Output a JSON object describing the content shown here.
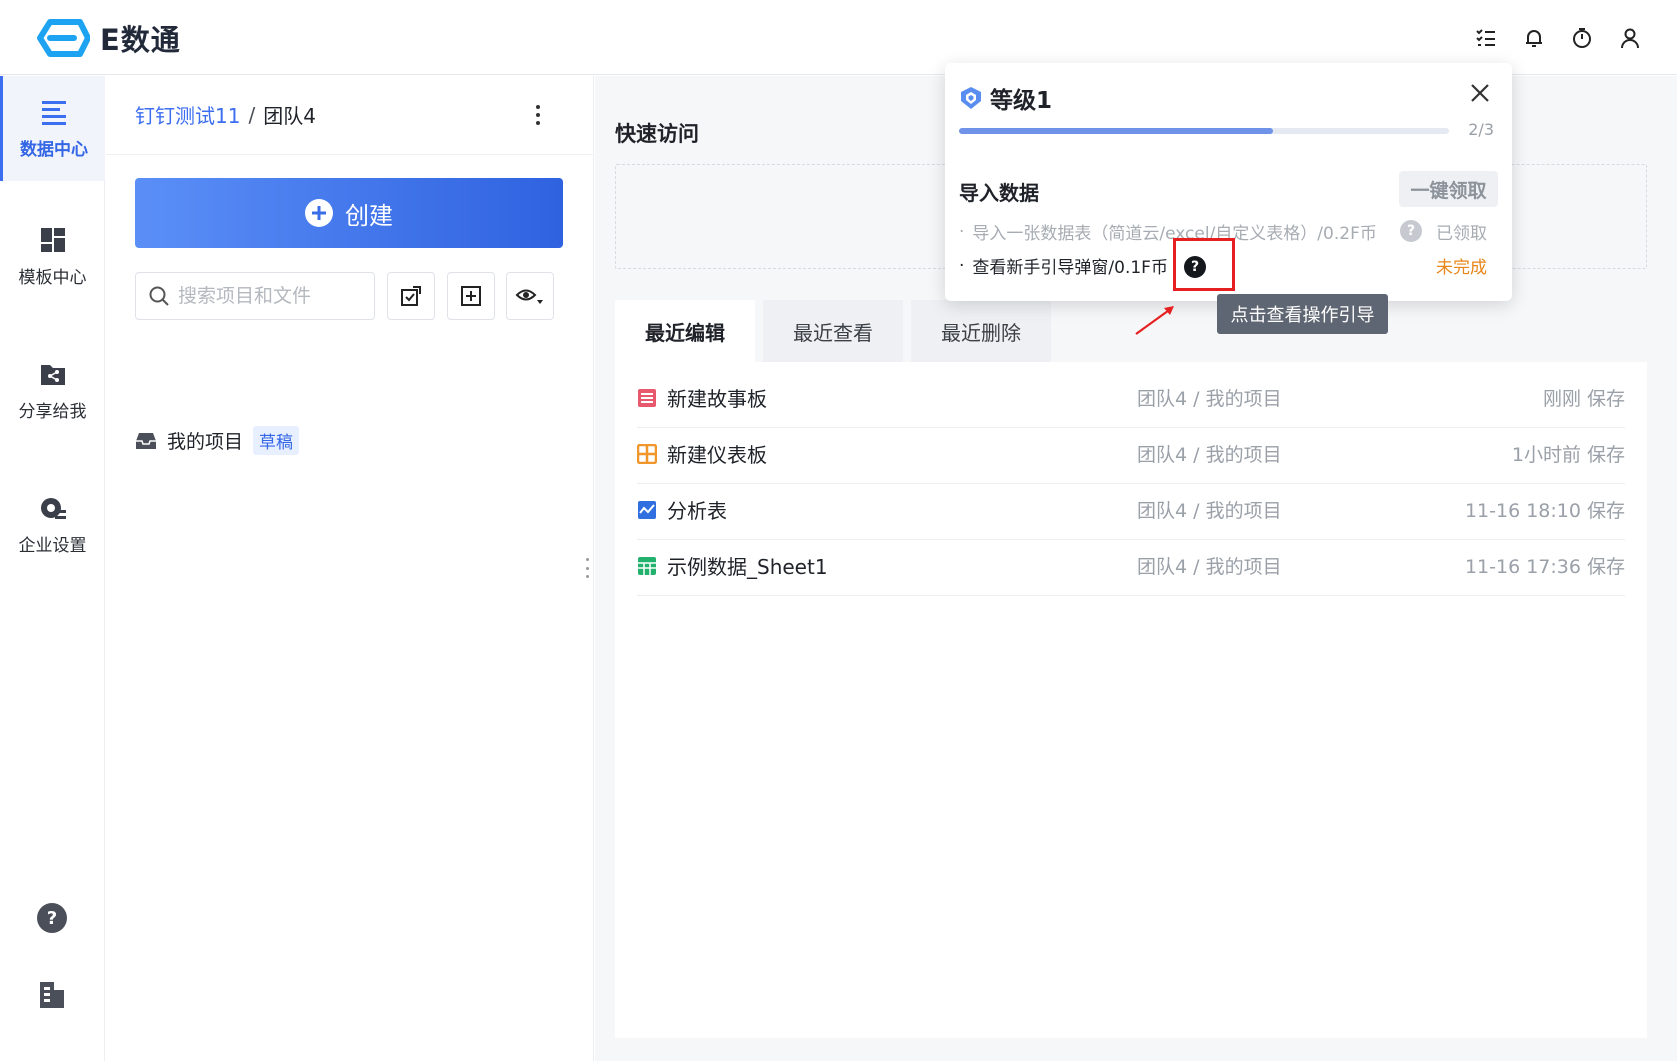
{
  "app": {
    "name": "E数通"
  },
  "header": {
    "icons": [
      "checklist-icon",
      "bell-icon",
      "timer-icon",
      "user-icon"
    ]
  },
  "nav": {
    "items": [
      {
        "label": "数据中心",
        "icon": "data-center-icon",
        "active": true
      },
      {
        "label": "模板中心",
        "icon": "template-icon",
        "active": false
      },
      {
        "label": "分享给我",
        "icon": "share-icon",
        "active": false
      },
      {
        "label": "企业设置",
        "icon": "settings-icon",
        "active": false
      }
    ],
    "bottom_icons": [
      "help-icon",
      "building-icon"
    ]
  },
  "project_panel": {
    "breadcrumb": {
      "org": "钉钉测试11",
      "separator": "/",
      "team": "团队4"
    },
    "create_label": "创建",
    "search_placeholder": "搜索项目和文件",
    "project": {
      "name": "我的项目",
      "badge": "草稿"
    }
  },
  "main": {
    "quick_access_title": "快速访问",
    "tabs": [
      {
        "label": "最近编辑",
        "active": true
      },
      {
        "label": "最近查看",
        "active": false
      },
      {
        "label": "最近删除",
        "active": false
      }
    ],
    "files": [
      {
        "name": "新建故事板",
        "path": "团队4 / 我的项目",
        "time": "刚刚 保存",
        "icon": "storyboard-icon",
        "color": "#e8596e"
      },
      {
        "name": "新建仪表板",
        "path": "团队4 / 我的项目",
        "time": "1小时前 保存",
        "icon": "dashboard-icon",
        "color": "#f0962a"
      },
      {
        "name": "分析表",
        "path": "团队4 / 我的项目",
        "time": "11-16 18:10 保存",
        "icon": "analysis-icon",
        "color": "#2f6fe0"
      },
      {
        "name": "示例数据_Sheet1",
        "path": "团队4 / 我的项目",
        "time": "11-16 17:36 保存",
        "icon": "sheet-icon",
        "color": "#23b26d"
      }
    ]
  },
  "level_popup": {
    "title": "等级1",
    "progress_text": "2/3",
    "progress": 0.64,
    "task_title": "导入数据",
    "claim_label": "一键领取",
    "tasks": [
      {
        "text": "导入一张数据表（简道云/excel/自定义表格）/0.2F币",
        "status": "已领取"
      },
      {
        "text": "查看新手引导弹窗/0.1F币",
        "status": "未完成"
      }
    ]
  },
  "tooltip": {
    "text": "点击查看操作引导"
  },
  "colors": {
    "accent": "#3c6ef0",
    "pending": "#e8861a",
    "highlight": "#e62020"
  }
}
